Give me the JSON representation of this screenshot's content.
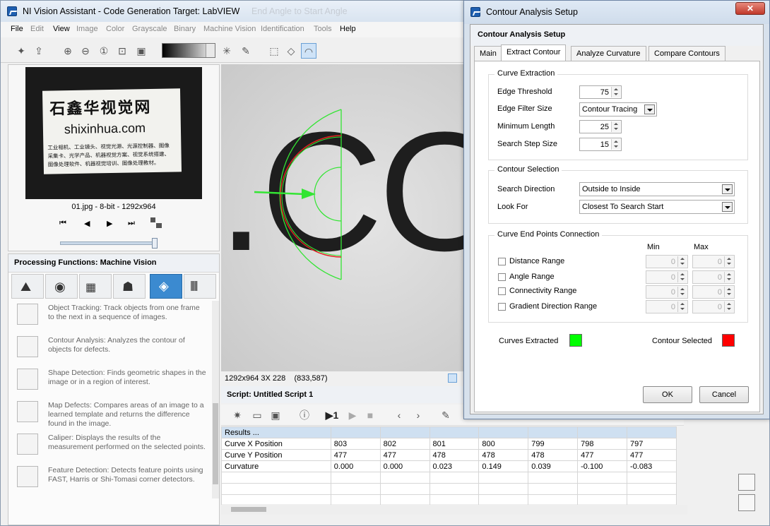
{
  "app": {
    "title": "NI Vision Assistant - Code Generation Target: LabVIEW",
    "ghost_title": "End Angle to Start Angle"
  },
  "menu": [
    "File",
    "Edit",
    "View",
    "Image",
    "Color",
    "Grayscale",
    "Binary",
    "Machine Vision",
    "Identification",
    "Tools",
    "Help"
  ],
  "menu_enabled": [
    "File",
    "View",
    "Help"
  ],
  "thumbnail": {
    "card_brand_cn": "石鑫华视觉网",
    "card_url": "shixinhua.com",
    "card_line1": "工业相机、工业镜头、视觉光源、光源控制器、图像",
    "card_line2": "采集卡、光学产品、机器视觉方案、视觉系统搭建、",
    "card_line3": "图像处理软件、机器视觉培训、图像处理教材。",
    "caption": "01.jpg - 8-bit - 1292x964"
  },
  "processing": {
    "header": "Processing Functions: Machine Vision",
    "functions": [
      {
        "name": "Object Tracking:",
        "desc": "Track objects from one frame to the next in a sequence of images."
      },
      {
        "name": "Contour Analysis:",
        "desc": "Analyzes the contour of objects for defects."
      },
      {
        "name": "Shape Detection:",
        "desc": "Finds geometric shapes in the image or in a region of interest."
      },
      {
        "name": "Map Defects:",
        "desc": "Compares areas of an image to a learned template and returns the difference found in the image."
      },
      {
        "name": "Caliper:",
        "desc": "Displays the results of the measurement performed on the selected points."
      },
      {
        "name": "Feature Detection:",
        "desc": "Detects feature points using FAST, Harris or Shi-Tomasi corner detectors."
      }
    ]
  },
  "imageview": {
    "text_glyphs": ".CO",
    "status": "1292x964 3X 228    (833,587)"
  },
  "script": {
    "title": "Script: Untitled Script 1",
    "step_label": "1"
  },
  "results": {
    "header": "Results ...",
    "rows": [
      {
        "label": "Curve X Position",
        "values": [
          "803",
          "802",
          "801",
          "800",
          "799",
          "798",
          "797"
        ]
      },
      {
        "label": "Curve Y Position",
        "values": [
          "477",
          "477",
          "478",
          "478",
          "478",
          "477",
          "477"
        ]
      },
      {
        "label": "Curvature",
        "values": [
          "0.000",
          "0.000",
          "0.023",
          "0.149",
          "0.039",
          "-0.100",
          "-0.083"
        ]
      }
    ]
  },
  "dialog": {
    "title": "Contour Analysis Setup",
    "close": "✕",
    "header": "Contour Analysis Setup",
    "tabs": [
      "Main",
      "Extract Contour",
      "Analyze Curvature",
      "Compare Contours"
    ],
    "active_tab": "Extract Contour",
    "curve_extraction": {
      "title": "Curve Extraction",
      "edge_threshold_label": "Edge Threshold",
      "edge_threshold": "75",
      "edge_filter_label": "Edge Filter Size",
      "edge_filter": "Contour Tracing",
      "min_length_label": "Minimum Length",
      "min_length": "25",
      "search_step_label": "Search Step Size",
      "search_step": "15"
    },
    "contour_selection": {
      "title": "Contour Selection",
      "direction_label": "Search Direction",
      "direction": "Outside to Inside",
      "look_for_label": "Look For",
      "look_for": "Closest To Search Start"
    },
    "endpoints": {
      "title": "Curve End Points Connection",
      "min_header": "Min",
      "max_header": "Max",
      "rows": [
        {
          "label": "Distance Range",
          "min": "0",
          "max": "0"
        },
        {
          "label": "Angle Range",
          "min": "0",
          "max": "0"
        },
        {
          "label": "Connectivity Range",
          "min": "0",
          "max": "0"
        },
        {
          "label": "Gradient Direction Range",
          "min": "0",
          "max": "0"
        }
      ]
    },
    "legend": {
      "extracted_label": "Curves Extracted",
      "extracted_color": "#00ff00",
      "selected_label": "Contour Selected",
      "selected_color": "#ff0000"
    },
    "ok": "OK",
    "cancel": "Cancel"
  }
}
